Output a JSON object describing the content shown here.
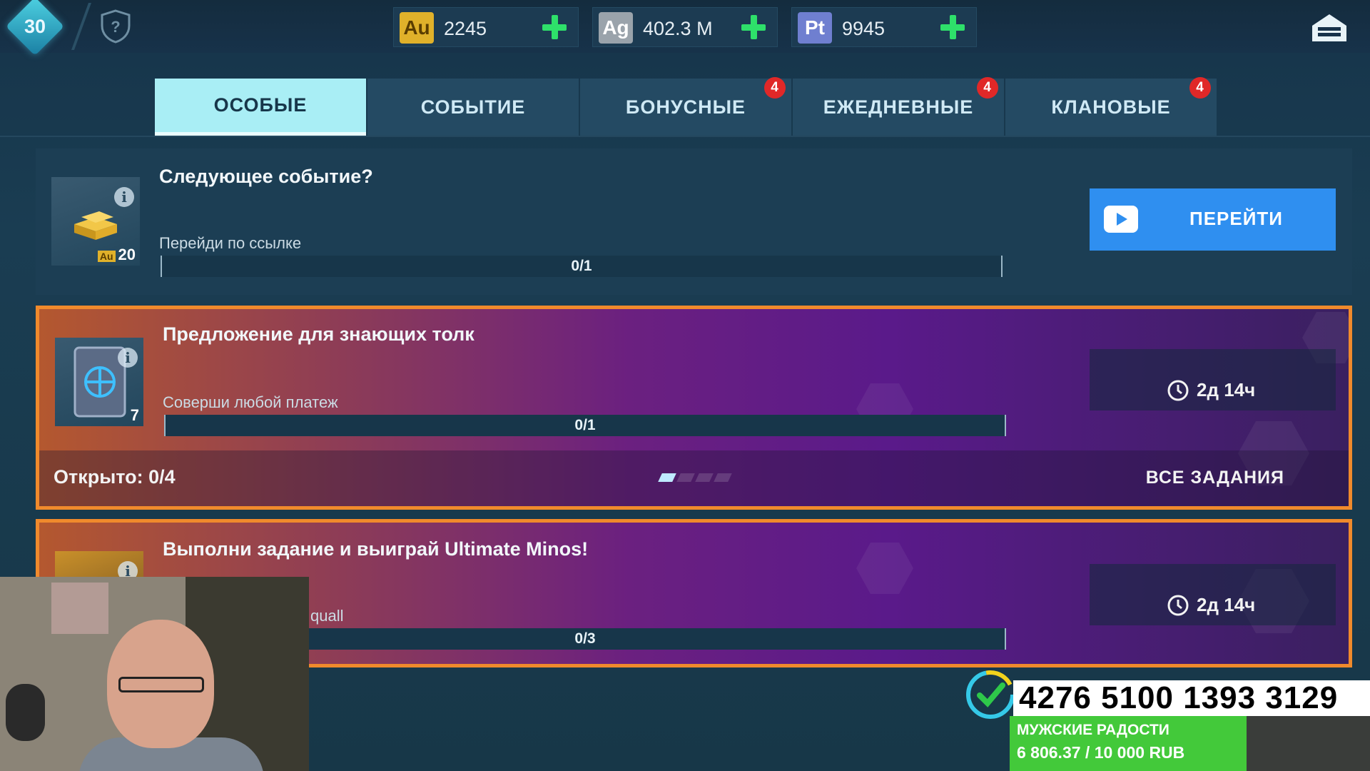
{
  "top_bar": {
    "level": "30",
    "currencies": [
      {
        "code": "Au",
        "value": "2245",
        "badge_color": "#e0b12a"
      },
      {
        "code": "Ag",
        "value": "402.3 M",
        "badge_color": "#9aa3ab"
      },
      {
        "code": "Pt",
        "value": "9945",
        "badge_color": "#6f7fd0"
      }
    ]
  },
  "tabs": [
    {
      "label": "ОСОБЫЕ",
      "active": true,
      "badge": ""
    },
    {
      "label": "СОБЫТИЕ",
      "active": false,
      "badge": ""
    },
    {
      "label": "БОНУСНЫЕ",
      "active": false,
      "badge": "4"
    },
    {
      "label": "ЕЖЕДНЕВНЫЕ",
      "active": false,
      "badge": "4"
    },
    {
      "label": "КЛАНОВЫЕ",
      "active": false,
      "badge": "4"
    }
  ],
  "quests": [
    {
      "title": "Следующее событие?",
      "description": "Перейди по ссылке",
      "progress_text": "0/1",
      "progress_fraction": 0,
      "reward_count": "20",
      "reward_currency": "Au",
      "button_label": "ПЕРЕЙТИ"
    },
    {
      "title": "Предложение для знающих толк",
      "description": "Соверши любой платеж",
      "progress_text": "0/1",
      "progress_fraction": 0,
      "reward_count": "7",
      "timer": "2д 14ч",
      "opened": "Открыто: 0/4",
      "all_tasks": "ВСЕ ЗАДАНИЯ"
    },
    {
      "title": "Выполни задание и выиграй Ultimate Minos!",
      "description": "quall",
      "progress_text": "0/3",
      "progress_fraction": 0,
      "timer": "2д 14ч"
    }
  ],
  "overlay": {
    "donation_number": "4276 5100 1393 3129",
    "goal_title": "МУЖСКИЕ РАДОСТИ",
    "goal_amount": "6 806.37 / 10 000 RUB",
    "goal_fraction": 0.68
  },
  "colors": {
    "accent_tab": "#a9eef5",
    "go_button": "#2f8ff0",
    "promo_border": "#f08a2c",
    "badge_red": "#e02828",
    "plus_green": "#2ee06a"
  }
}
